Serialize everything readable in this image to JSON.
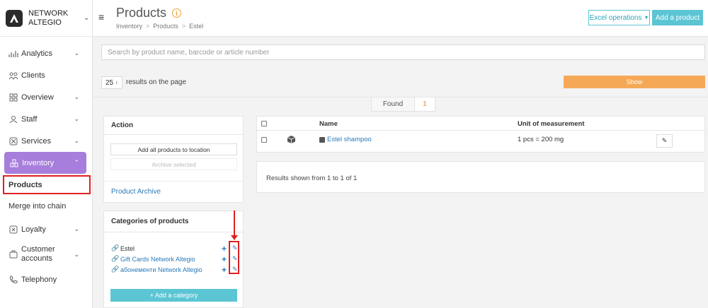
{
  "brand": {
    "name": "NETWORK ALTEGIO"
  },
  "sidebar": {
    "items": [
      {
        "label": "Analytics",
        "icon": "analytics-icon",
        "has_chevron": true
      },
      {
        "label": "Clients",
        "icon": "clients-icon",
        "has_chevron": false
      },
      {
        "label": "Overview",
        "icon": "overview-icon",
        "has_chevron": true
      },
      {
        "label": "Staff",
        "icon": "staff-icon",
        "has_chevron": true
      },
      {
        "label": "Services",
        "icon": "services-icon",
        "has_chevron": true
      },
      {
        "label": "Inventory",
        "icon": "inventory-icon",
        "has_chevron": true,
        "active": true
      }
    ],
    "subitems": [
      {
        "label": "Products",
        "selected": true
      },
      {
        "label": "Merge into chain",
        "selected": false
      }
    ],
    "items_after": [
      {
        "label": "Loyalty",
        "icon": "loyalty-icon"
      },
      {
        "label": "Customer accounts",
        "icon": "customer-accounts-icon"
      },
      {
        "label": "Telephony",
        "icon": "telephony-icon"
      }
    ]
  },
  "header": {
    "title": "Products",
    "breadcrumb": [
      "Inventory",
      "Products",
      "Estel"
    ],
    "excel_button": "Excel operations",
    "add_button": "Add a product"
  },
  "search": {
    "placeholder": "Search by product name, barcode or article number"
  },
  "pagination": {
    "per_page": "25",
    "per_page_label": "results on the page",
    "show_button": "Show"
  },
  "found": {
    "label": "Found",
    "count": "1"
  },
  "action_panel": {
    "title": "Action",
    "add_all_button": "Add all products to location",
    "archive_selected_button": "Archive selected",
    "archive_link": "Product Archive"
  },
  "categories": {
    "title": "Categories of products",
    "items": [
      {
        "name": "Estel",
        "is_link": false
      },
      {
        "name": "Gift Cards Network Altegio",
        "is_link": true
      },
      {
        "name": "абонементи Network Altegio",
        "is_link": true
      }
    ],
    "add_button": "+ Add a category"
  },
  "table": {
    "headers": {
      "name": "Name",
      "unit": "Unit of measurement"
    },
    "rows": [
      {
        "name": "Estel shampoo",
        "unit": "1 pcs = 200 mg"
      }
    ]
  },
  "results_text": "Results shown from 1 to 1 of 1",
  "colors": {
    "accent_purple": "#a77edb",
    "accent_cyan": "#5cc5d4",
    "accent_orange": "#f5a957",
    "link_blue": "#2a7ab8",
    "highlight_red": "#e02020"
  }
}
